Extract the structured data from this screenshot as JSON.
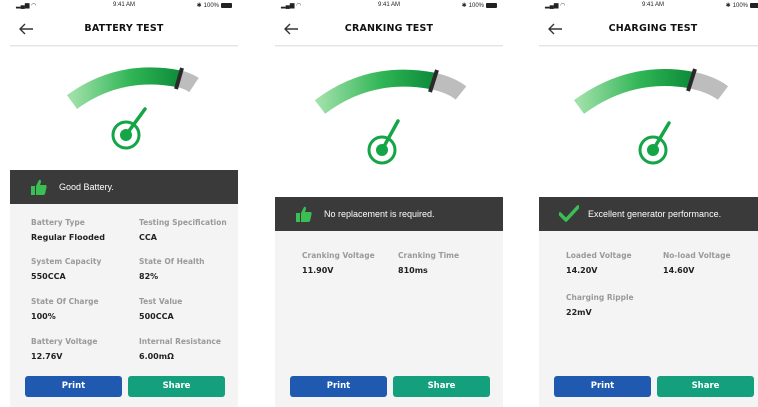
{
  "status_bar": {
    "time": "9:41 AM",
    "battery": "100%"
  },
  "buttons": {
    "print": "Print",
    "share": "Share"
  },
  "colors": {
    "gauge_green": "#14a546",
    "gauge_gray": "#bdbdbd",
    "banner_bg": "#3a3a3a",
    "print_blue": "#1f5ab0",
    "share_teal": "#14a07d"
  },
  "screens": [
    {
      "title": "BATTERY TEST",
      "banner_icon": "thumbs-up-icon",
      "banner_text": "Good Battery.",
      "fields": [
        {
          "label": "Battery Type",
          "value": "Regular Flooded"
        },
        {
          "label": "Testing Specification",
          "value": "CCA"
        },
        {
          "label": "System Capacity",
          "value": "550CCA"
        },
        {
          "label": "State Of Health",
          "value": "82%"
        },
        {
          "label": "State Of Charge",
          "value": "100%"
        },
        {
          "label": "Test Value",
          "value": "500CCA"
        },
        {
          "label": "Battery Voltage",
          "value": "12.76V"
        },
        {
          "label": "Internal Resistance",
          "value": "6.00mΩ"
        }
      ]
    },
    {
      "title": "CRANKING TEST",
      "banner_icon": "thumbs-up-icon",
      "banner_text": "No replacement is required.",
      "fields": [
        {
          "label": "Cranking Voltage",
          "value": "11.90V"
        },
        {
          "label": "Cranking Time",
          "value": "810ms"
        }
      ]
    },
    {
      "title": "CHARGING TEST",
      "banner_icon": "checkmark-icon",
      "banner_text": "Excellent generator performance.",
      "fields": [
        {
          "label": "Loaded Voltage",
          "value": "14.20V"
        },
        {
          "label": "No-load Voltage",
          "value": "14.60V"
        },
        {
          "label": "Charging Ripple",
          "value": "22mV"
        }
      ]
    }
  ]
}
